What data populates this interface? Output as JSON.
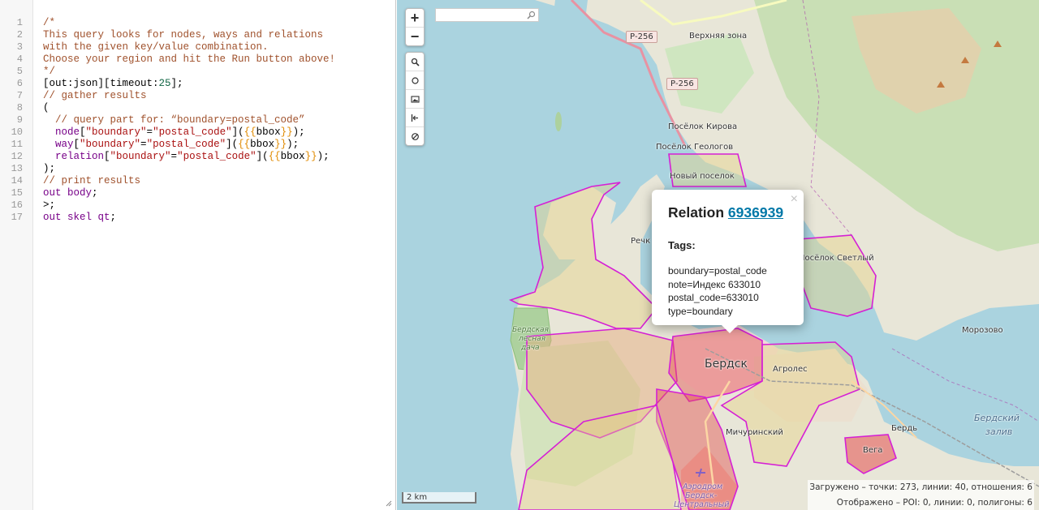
{
  "editor": {
    "line_numbers": [
      "1",
      "2",
      "3",
      "4",
      "5",
      "6",
      "7",
      "8",
      "9",
      "10",
      "11",
      "12",
      "13",
      "14",
      "15",
      "16",
      "17"
    ],
    "lines": [
      [
        {
          "t": "/*",
          "c": "c-comment"
        }
      ],
      [
        {
          "t": "This query looks for nodes, ways and relations",
          "c": "c-comment"
        }
      ],
      [
        {
          "t": "with the given key/value combination.",
          "c": "c-comment"
        }
      ],
      [
        {
          "t": "Choose your region and hit the Run button above!",
          "c": "c-comment"
        }
      ],
      [
        {
          "t": "*/",
          "c": "c-comment"
        }
      ],
      [
        {
          "t": "[out:json][timeout:",
          "c": ""
        },
        {
          "t": "25",
          "c": "c-num"
        },
        {
          "t": "];",
          "c": ""
        }
      ],
      [
        {
          "t": "// gather results",
          "c": "c-comment"
        }
      ],
      [
        {
          "t": "(",
          "c": ""
        }
      ],
      [
        {
          "t": "  // query part for: “boundary=postal_code”",
          "c": "c-comment"
        }
      ],
      [
        {
          "t": "  node",
          "c": "c-kw"
        },
        {
          "t": "[",
          "c": ""
        },
        {
          "t": "\"boundary\"",
          "c": "c-str"
        },
        {
          "t": "=",
          "c": ""
        },
        {
          "t": "\"postal_code\"",
          "c": "c-str"
        },
        {
          "t": "](",
          "c": ""
        },
        {
          "t": "{{",
          "c": "c-brace"
        },
        {
          "t": "bbox",
          "c": ""
        },
        {
          "t": "}}",
          "c": "c-brace"
        },
        {
          "t": ");",
          "c": ""
        }
      ],
      [
        {
          "t": "  way",
          "c": "c-kw"
        },
        {
          "t": "[",
          "c": ""
        },
        {
          "t": "\"boundary\"",
          "c": "c-str"
        },
        {
          "t": "=",
          "c": ""
        },
        {
          "t": "\"postal_code\"",
          "c": "c-str"
        },
        {
          "t": "](",
          "c": ""
        },
        {
          "t": "{{",
          "c": "c-brace"
        },
        {
          "t": "bbox",
          "c": ""
        },
        {
          "t": "}}",
          "c": "c-brace"
        },
        {
          "t": ");",
          "c": ""
        }
      ],
      [
        {
          "t": "  relation",
          "c": "c-kw"
        },
        {
          "t": "[",
          "c": ""
        },
        {
          "t": "\"boundary\"",
          "c": "c-str"
        },
        {
          "t": "=",
          "c": ""
        },
        {
          "t": "\"postal_code\"",
          "c": "c-str"
        },
        {
          "t": "](",
          "c": ""
        },
        {
          "t": "{{",
          "c": "c-brace"
        },
        {
          "t": "bbox",
          "c": ""
        },
        {
          "t": "}}",
          "c": "c-brace"
        },
        {
          "t": ");",
          "c": ""
        }
      ],
      [
        {
          "t": ");",
          "c": ""
        }
      ],
      [
        {
          "t": "// print results",
          "c": "c-comment"
        }
      ],
      [
        {
          "t": "out body",
          "c": "c-kw"
        },
        {
          "t": ";",
          "c": ""
        }
      ],
      [
        {
          "t": ">;",
          "c": ""
        }
      ],
      [
        {
          "t": "out skel qt",
          "c": "c-kw"
        },
        {
          "t": ";",
          "c": ""
        }
      ]
    ]
  },
  "map": {
    "zoom_in": "+",
    "zoom_out": "−",
    "tools": [
      "zoom-to-data-icon",
      "locate-icon",
      "export-image-icon",
      "fit-bounds-icon",
      "clear-icon"
    ],
    "search": {
      "placeholder": ""
    },
    "roads": [
      "Р-256",
      "Р-256"
    ],
    "labels": {
      "verkhnyaya_zona": "Верхняя зона",
      "poselok_kirova": "Посёлок Кирова",
      "poselok_geologov": "Посёлок Геологов",
      "novyi_poselok": "Новый поселок",
      "rechk": "Речк",
      "poselok_svetlyi": "Посёлок Светлый",
      "morozovo": "Морозово",
      "berdskaya_lesnaya_dacha_1": "Бердская",
      "berdskaya_lesnaya_dacha_2": "лесная",
      "berdskaya_lesnaya_dacha_3": "дача",
      "berdsk": "Бердск",
      "agroles": "Агролес",
      "michurinskii": "Мичуринский",
      "berd": "Бердь",
      "vega": "Вега",
      "berdskii_zaliv_1": "Бердский",
      "berdskii_zaliv_2": "залив",
      "aerodrom_1": "Аэродром",
      "aerodrom_2": "Бердск-",
      "aerodrom_3": "Центральный"
    },
    "scale": "2 km",
    "status_line1": "Загружено – точки: 273, линии: 40, отношения: 6",
    "status_line2": "Отображено – POI: 0, линии: 0, полигоны: 6"
  },
  "popup": {
    "title_prefix": "Relation",
    "relation_id": "6936939",
    "close": "×",
    "tags_heading": "Tags:",
    "tags": [
      "boundary=postal_code",
      "note=Индекс 633010",
      "postal_code=633010",
      "type=boundary"
    ]
  },
  "colors": {
    "water": "#aad3df",
    "forest": "#add19e",
    "boundary": "#d520d5",
    "urban": "#f2dad9",
    "popup_link": "#0078a8"
  }
}
